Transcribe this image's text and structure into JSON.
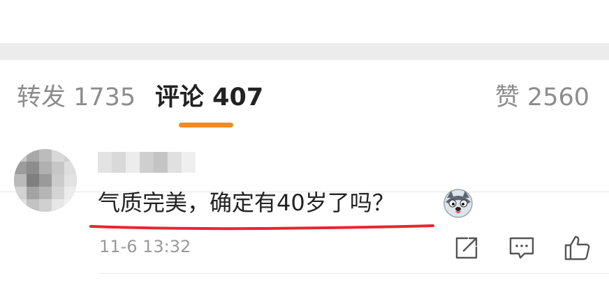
{
  "tabs": {
    "repost_label": "转发 1735",
    "comments_label": "评论 407",
    "likes_label": "赞 2560",
    "active_color": "#f08a24"
  },
  "comment": {
    "text": "气质完美，确定有40岁了吗？",
    "timestamp": "11-6 13:32",
    "emoji_icon": "husky-emoji-icon",
    "highlight_color": "#e8262e"
  },
  "actions": {
    "share_icon": "share-icon",
    "reply_icon": "reply-icon",
    "like_icon": "thumbs-up-icon"
  }
}
